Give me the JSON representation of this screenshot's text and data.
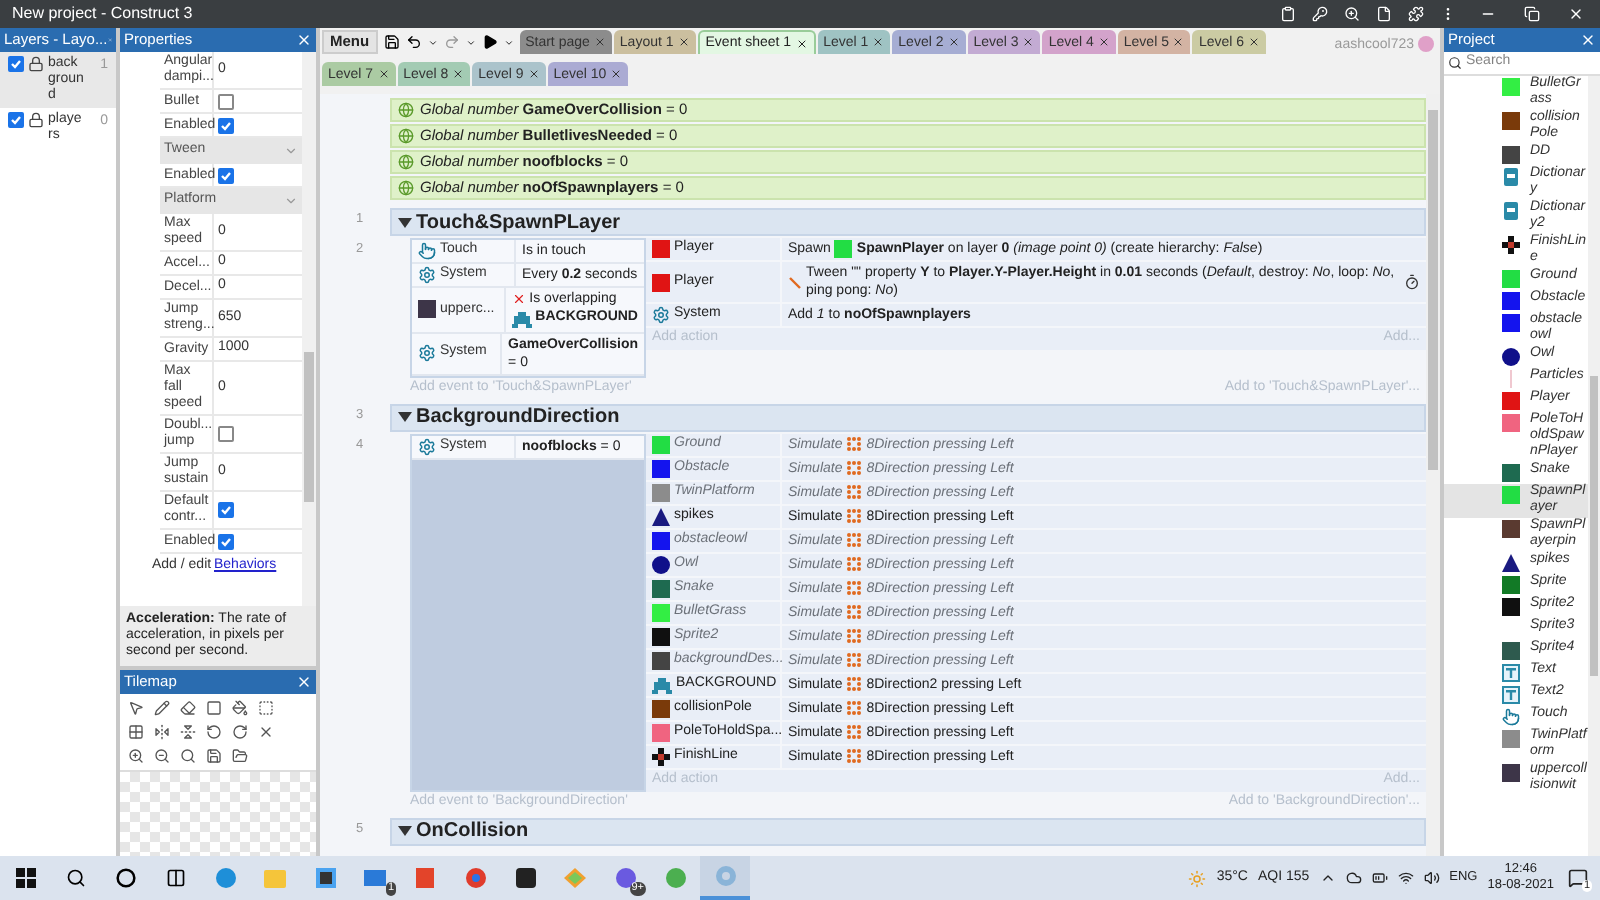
{
  "window": {
    "title": "New project - Construct 3"
  },
  "layers_panel": {
    "title": "Layers - Layo...",
    "layers": [
      {
        "name": "background",
        "count": "1",
        "visible": true,
        "selected": true
      },
      {
        "name": "players",
        "count": "0",
        "visible": true,
        "selected": false
      }
    ]
  },
  "properties_panel": {
    "title": "Properties",
    "rows": [
      {
        "kind": "field",
        "label": "Angular dampi...",
        "value": "0"
      },
      {
        "kind": "checkbox",
        "label": "Bullet",
        "checked": false
      },
      {
        "kind": "checkbox",
        "label": "Enabled",
        "checked": true
      },
      {
        "kind": "section",
        "label": "Tween"
      },
      {
        "kind": "checkbox",
        "label": "Enabled",
        "checked": true
      },
      {
        "kind": "section",
        "label": "Platform"
      },
      {
        "kind": "field",
        "label": "Max speed",
        "value": "0"
      },
      {
        "kind": "field",
        "label": "Accel...",
        "value": "0"
      },
      {
        "kind": "field",
        "label": "Decel...",
        "value": "0"
      },
      {
        "kind": "field",
        "label": "Jump streng...",
        "value": "650"
      },
      {
        "kind": "field",
        "label": "Gravity",
        "value": "1000"
      },
      {
        "kind": "field",
        "label": "Max fall speed",
        "value": "0"
      },
      {
        "kind": "checkbox",
        "label": "Doubl... jump",
        "checked": false
      },
      {
        "kind": "field",
        "label": "Jump sustain",
        "value": "0"
      },
      {
        "kind": "checkbox",
        "label": "Default contr...",
        "checked": true
      },
      {
        "kind": "checkbox",
        "label": "Enabled",
        "checked": true
      },
      {
        "kind": "link",
        "label": "Add / edit",
        "value": "Behaviors"
      }
    ],
    "description": "**Acceleration:** The rate of acceleration, in pixels per second per second."
  },
  "tilemap_panel": {
    "title": "Tilemap"
  },
  "toolbar": {
    "menu": "Menu"
  },
  "tabs": [
    {
      "label": "Start page",
      "color": "#8c8c8c",
      "selected": false
    },
    {
      "label": "Layout 1",
      "color": "#cbbf9f",
      "selected": false
    },
    {
      "label": "Event sheet 1",
      "color": "#e3f7e3",
      "selected": true
    },
    {
      "label": "Level 1",
      "color": "#9fc3c3",
      "selected": false
    },
    {
      "label": "Level 2",
      "color": "#a6add3",
      "selected": false
    },
    {
      "label": "Level 3",
      "color": "#c3abd3",
      "selected": false
    },
    {
      "label": "Level 4",
      "color": "#d3a3cb",
      "selected": false
    },
    {
      "label": "Level 5",
      "color": "#d3b3a3",
      "selected": false
    },
    {
      "label": "Level 6",
      "color": "#cbcba3",
      "selected": false
    },
    {
      "label": "Level 7",
      "color": "#abcba3",
      "selected": false
    },
    {
      "label": "Level 8",
      "color": "#a3cbb3",
      "selected": false
    },
    {
      "label": "Level 9",
      "color": "#abc3cb",
      "selected": false
    },
    {
      "label": "Level 10",
      "color": "#ababd3",
      "selected": false
    }
  ],
  "user": "aashcool723",
  "globals": [
    {
      "text": "*Global number* **GameOverCollision** = 0"
    },
    {
      "text": "*Global number* **BulletlivesNeeded** = 0"
    },
    {
      "text": "*Global number* **noofblocks** = 0"
    },
    {
      "text": "*Global number* **noOfSpawnplayers** = 0"
    }
  ],
  "groups": [
    {
      "number": "1",
      "title": "Touch&SpawnPLayer",
      "expanded": true,
      "events": [
        {
          "number": "2",
          "conditions": [
            {
              "object": {
                "kind": "touch",
                "name": "Touch"
              },
              "text": "Is in touch",
              "inverted": false
            },
            {
              "object": {
                "kind": "system",
                "name": "System"
              },
              "text": "Every **0.2** seconds",
              "inverted": false
            },
            {
              "object": {
                "kind": "square",
                "color": "#3d3548",
                "name": "upperc..."
              },
              "text": "Is overlapping",
              "param": "BACKGROUND",
              "inverted": true
            },
            {
              "object": {
                "kind": "system",
                "name": "System"
              },
              "text": "**GameOverCollision** = 0",
              "inverted": false
            }
          ],
          "actions": [
            {
              "kind": "spawn",
              "object": {
                "kind": "square",
                "color": "#e01414",
                "name": "Player"
              },
              "verb": "Spawn",
              "text": "**SpawnPlayer** on layer **0** *(image point 0)* (create hierarchy: *False*)",
              "disabled": false
            },
            {
              "kind": "tween",
              "object": {
                "kind": "square",
                "color": "#e01414",
                "name": "Player"
              },
              "text": "Tween \"\" property **Y** to **Player.Y-Player.Height** in **0.01** seconds (*Default*, destroy: *No*, loop: *No*, ping pong: *No*)",
              "disabled": false
            },
            {
              "kind": "plain",
              "object": {
                "kind": "system",
                "name": "System"
              },
              "text": "Add *1* to **noOfSpawnplayers**",
              "disabled": false
            }
          ],
          "add_action": "Add action",
          "add": "Add..."
        }
      ],
      "add_event": "Add event to 'Touch&SpawnPLayer'",
      "add_to": "Add to 'Touch&SpawnPLayer'..."
    },
    {
      "number": "3",
      "title": "BackgroundDirection",
      "expanded": true,
      "events": [
        {
          "number": "4",
          "conditions": [
            {
              "object": {
                "kind": "system",
                "name": "System"
              },
              "text": "**noofblocks** = 0",
              "inverted": false
            }
          ],
          "actions": [
            {
              "kind": "simulate",
              "object": {
                "kind": "square",
                "color": "#22dd44",
                "name": "Ground"
              },
              "verb": "Simulate",
              "param": "8Direction pressing Left",
              "disabled": true
            },
            {
              "kind": "simulate",
              "object": {
                "kind": "square",
                "color": "#1414ee",
                "name": "Obstacle"
              },
              "verb": "Simulate",
              "param": "8Direction pressing Left",
              "disabled": true
            },
            {
              "kind": "simulate",
              "object": {
                "kind": "square",
                "color": "#8c8c8c",
                "name": "TwinPlatform"
              },
              "verb": "Simulate",
              "param": "8Direction pressing Left",
              "disabled": true
            },
            {
              "kind": "simulate",
              "object": {
                "kind": "triangle",
                "color": "#1a1a80",
                "name": "spikes"
              },
              "verb": "Simulate",
              "param": "8Direction pressing Left",
              "disabled": false
            },
            {
              "kind": "simulate",
              "object": {
                "kind": "square",
                "color": "#1414ee",
                "name": "obstacleowl"
              },
              "verb": "Simulate",
              "param": "8Direction pressing Left",
              "disabled": true
            },
            {
              "kind": "simulate",
              "object": {
                "kind": "circle",
                "color": "#10108a",
                "name": "Owl"
              },
              "verb": "Simulate",
              "param": "8Direction pressing Left",
              "disabled": true
            },
            {
              "kind": "simulate",
              "object": {
                "kind": "square",
                "color": "#1e6a50",
                "name": "Snake"
              },
              "verb": "Simulate",
              "param": "8Direction pressing Left",
              "disabled": true
            },
            {
              "kind": "simulate",
              "object": {
                "kind": "square",
                "color": "#33ee44",
                "name": "BulletGrass"
              },
              "verb": "Simulate",
              "param": "8Direction pressing Left",
              "disabled": true
            },
            {
              "kind": "simulate",
              "object": {
                "kind": "square",
                "color": "#101010",
                "name": "Sprite2"
              },
              "verb": "Simulate",
              "param": "8Direction pressing Left",
              "disabled": true
            },
            {
              "kind": "simulate",
              "object": {
                "kind": "square",
                "color": "#444444",
                "name": "backgroundDes..."
              },
              "verb": "Simulate",
              "param": "8Direction pressing Left",
              "disabled": true
            },
            {
              "kind": "simulate",
              "object": {
                "kind": "tiles",
                "name": "BACKGROUND"
              },
              "verb": "Simulate",
              "param": "8Direction2 pressing Left",
              "disabled": false
            },
            {
              "kind": "simulate",
              "object": {
                "kind": "square",
                "color": "#7a3a0a",
                "name": "collisionPole"
              },
              "verb": "Simulate",
              "param": "8Direction pressing Left",
              "disabled": false
            },
            {
              "kind": "simulate",
              "object": {
                "kind": "square",
                "color": "#f06480",
                "name": "PoleToHoldSpa..."
              },
              "verb": "Simulate",
              "param": "8Direction pressing Left",
              "disabled": false
            },
            {
              "kind": "simulate",
              "object": {
                "kind": "checker",
                "name": "FinishLine"
              },
              "verb": "Simulate",
              "param": "8Direction pressing Left",
              "disabled": false
            }
          ],
          "add_action": "Add action",
          "add": "Add..."
        }
      ],
      "add_event": "Add event to 'BackgroundDirection'",
      "add_to": "Add to 'BackgroundDirection'..."
    },
    {
      "number": "5",
      "title": "OnCollision",
      "expanded": true
    }
  ],
  "project_panel": {
    "title": "Project",
    "search": {
      "placeholder": "Search"
    },
    "items": [
      {
        "name": "BulletGrass",
        "kind": "square",
        "color": "#33ee44",
        "selected": false
      },
      {
        "name": "collisionPole",
        "kind": "square",
        "color": "#7a3a0a",
        "selected": false
      },
      {
        "name": "DD",
        "kind": "square",
        "color": "#444444",
        "selected": false
      },
      {
        "name": "Dictionary",
        "kind": "dictionary",
        "selected": false
      },
      {
        "name": "Dictionary2",
        "kind": "dictionary",
        "selected": false
      },
      {
        "name": "FinishLine",
        "kind": "checker",
        "selected": false
      },
      {
        "name": "Ground",
        "kind": "square",
        "color": "#22dd44",
        "selected": false
      },
      {
        "name": "Obstacle",
        "kind": "square",
        "color": "#1414ee",
        "selected": false
      },
      {
        "name": "obstacleowl",
        "kind": "square",
        "color": "#1414ee",
        "selected": false
      },
      {
        "name": "Owl",
        "kind": "circle",
        "color": "#10108a",
        "selected": false
      },
      {
        "name": "Particles",
        "kind": "particles",
        "selected": false
      },
      {
        "name": "Player",
        "kind": "square",
        "color": "#e01414",
        "selected": false
      },
      {
        "name": "PoleToHoldSpawnPlayer",
        "kind": "square",
        "color": "#f06480",
        "selected": false
      },
      {
        "name": "Snake",
        "kind": "square",
        "color": "#1e6a50",
        "selected": false
      },
      {
        "name": "SpawnPlayer",
        "kind": "square",
        "color": "#22dd44",
        "selected": true
      },
      {
        "name": "SpawnPlayerpin",
        "kind": "square",
        "color": "#5a3a30",
        "selected": false
      },
      {
        "name": "spikes",
        "kind": "triangle",
        "color": "#1a1a80",
        "selected": false
      },
      {
        "name": "Sprite",
        "kind": "square",
        "color": "#127a26",
        "selected": false
      },
      {
        "name": "Sprite2",
        "kind": "square",
        "color": "#101010",
        "selected": false
      },
      {
        "name": "Sprite3",
        "kind": "none",
        "selected": false
      },
      {
        "name": "Sprite4",
        "kind": "square",
        "color": "#2e5a4e",
        "selected": false
      },
      {
        "name": "Text",
        "kind": "text",
        "selected": false
      },
      {
        "name": "Text2",
        "kind": "text",
        "selected": false
      },
      {
        "name": "Touch",
        "kind": "touch",
        "selected": false
      },
      {
        "name": "TwinPlatform",
        "kind": "square",
        "color": "#8c8c8c",
        "selected": false
      },
      {
        "name": "uppercollisionwit",
        "kind": "square",
        "color": "#3d3548",
        "selected": false
      }
    ]
  },
  "taskbar": {
    "apps": [
      {
        "kind": "start",
        "active": false
      },
      {
        "kind": "search",
        "active": false
      },
      {
        "kind": "cortana",
        "active": false
      },
      {
        "kind": "taskview",
        "active": false
      },
      {
        "kind": "edge",
        "active": false
      },
      {
        "kind": "explorer",
        "active": false
      },
      {
        "kind": "store",
        "active": false
      },
      {
        "kind": "mail",
        "active": false,
        "badge": "1"
      },
      {
        "kind": "office",
        "active": false
      },
      {
        "kind": "chrome",
        "active": false
      },
      {
        "kind": "dark",
        "active": false
      },
      {
        "kind": "shapes",
        "active": false
      },
      {
        "kind": "messenger",
        "active": false,
        "badge": "9+"
      },
      {
        "kind": "torrent",
        "active": false
      },
      {
        "kind": "construct",
        "active": true
      }
    ],
    "temperature": "35°C",
    "aqi": "AQI 155",
    "language": "ENG",
    "time": "12:46",
    "date": "18-08-2021",
    "notifications": "1"
  }
}
